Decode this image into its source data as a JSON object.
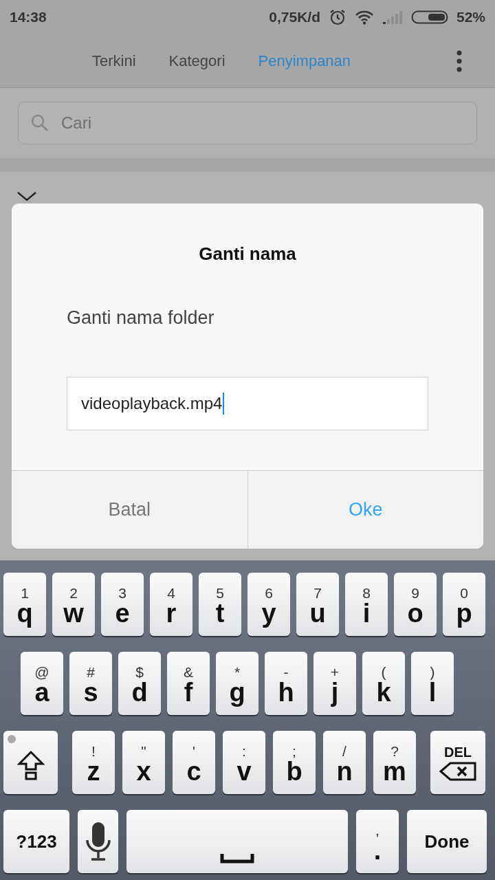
{
  "status_bar": {
    "time": "14:38",
    "net_speed": "0,75K/d",
    "battery": "52%"
  },
  "tabs": [
    {
      "label": "Terkini",
      "selected": false
    },
    {
      "label": "Kategori",
      "selected": false
    },
    {
      "label": "Penyimpanan",
      "selected": true
    }
  ],
  "search": {
    "placeholder": "Cari"
  },
  "dialog": {
    "title": "Ganti nama",
    "message": "Ganti nama folder",
    "value": "videoplayback.mp4",
    "buttons": [
      {
        "label": "Batal",
        "kind": "cancel"
      },
      {
        "label": "Oke",
        "kind": "confirm"
      }
    ]
  },
  "keyboard": [
    [
      {
        "kind": "letter",
        "label": "q",
        "hint": "1"
      },
      {
        "kind": "letter",
        "label": "w",
        "hint": "2"
      },
      {
        "kind": "letter",
        "label": "e",
        "hint": "3"
      },
      {
        "kind": "letter",
        "label": "r",
        "hint": "4"
      },
      {
        "kind": "letter",
        "label": "t",
        "hint": "5"
      },
      {
        "kind": "letter",
        "label": "y",
        "hint": "6"
      },
      {
        "kind": "letter",
        "label": "u",
        "hint": "7"
      },
      {
        "kind": "letter",
        "label": "i",
        "hint": "8"
      },
      {
        "kind": "letter",
        "label": "o",
        "hint": "9"
      },
      {
        "kind": "letter",
        "label": "p",
        "hint": "0"
      }
    ],
    [
      {
        "kind": "letter",
        "label": "a",
        "hint": "@"
      },
      {
        "kind": "letter",
        "label": "s",
        "hint": "#"
      },
      {
        "kind": "letter",
        "label": "d",
        "hint": "$"
      },
      {
        "kind": "letter",
        "label": "f",
        "hint": "&"
      },
      {
        "kind": "letter",
        "label": "g",
        "hint": "*"
      },
      {
        "kind": "letter",
        "label": "h",
        "hint": "-"
      },
      {
        "kind": "letter",
        "label": "j",
        "hint": "+"
      },
      {
        "kind": "letter",
        "label": "k",
        "hint": "("
      },
      {
        "kind": "letter",
        "label": "l",
        "hint": ")"
      }
    ],
    [
      {
        "kind": "shift"
      },
      {
        "kind": "letter",
        "label": "z",
        "hint": "!"
      },
      {
        "kind": "letter",
        "label": "x",
        "hint": "\""
      },
      {
        "kind": "letter",
        "label": "c",
        "hint": "'"
      },
      {
        "kind": "letter",
        "label": "v",
        "hint": ":"
      },
      {
        "kind": "letter",
        "label": "b",
        "hint": ";"
      },
      {
        "kind": "letter",
        "label": "n",
        "hint": "/"
      },
      {
        "kind": "letter",
        "label": "m",
        "hint": "?"
      },
      {
        "kind": "delete",
        "label": "DEL"
      }
    ],
    [
      {
        "kind": "symbols",
        "label": "?123"
      },
      {
        "kind": "mic"
      },
      {
        "kind": "space"
      },
      {
        "kind": "letter",
        "label": ".",
        "hint": ","
      },
      {
        "kind": "done",
        "label": "Done"
      }
    ]
  ]
}
